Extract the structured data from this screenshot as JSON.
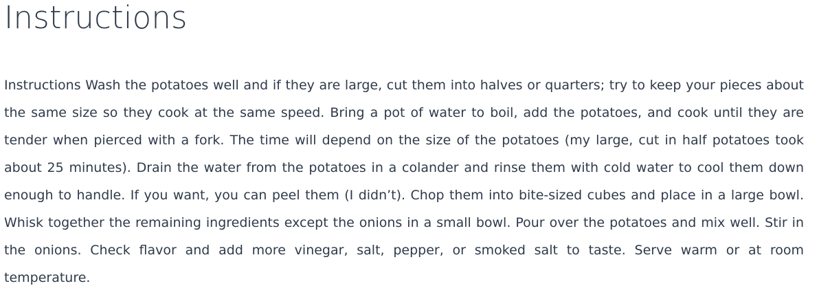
{
  "recipe": {
    "section_title": "Instructions",
    "instructions_text": "Instructions Wash the potatoes well and if they are large, cut them into halves or quarters; try to keep your pieces about the same size so they cook at the same speed. Bring a pot of water to boil, add the potatoes, and cook until they are tender when pierced with a fork. The time will depend on the size of the potatoes (my large, cut in half potatoes took about 25 minutes). Drain the water from the potatoes in a colander and rinse them with cold water to cool them down enough to handle. If you want, you can peel them (I didn’t). Chop them into bite-sized cubes and place in a large bowl. Whisk together the remaining ingredients except the onions in a small bowl. Pour over the potatoes and mix well. Stir in the onions. Check flavor and add more vinegar, salt, pepper, or smoked salt to taste. Serve warm or at room temperature."
  },
  "colors": {
    "text": "#2f3a4a",
    "background": "#ffffff"
  }
}
